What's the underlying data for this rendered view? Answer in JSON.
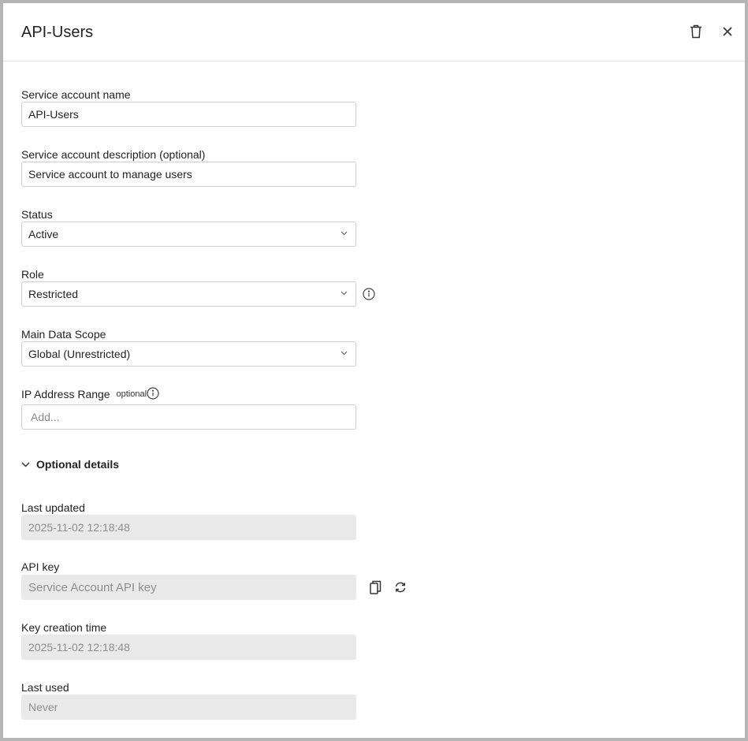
{
  "dialog": {
    "title": "API-Users",
    "delete_icon": "trash-icon",
    "close_icon": "close-icon"
  },
  "fields": {
    "name": {
      "label": "Service account name",
      "value": "API-Users"
    },
    "description": {
      "label": "Service account description (optional)",
      "value": "Service account to manage users"
    },
    "status": {
      "label": "Status",
      "value": "Active"
    },
    "role": {
      "label": "Role",
      "value": "Restricted"
    },
    "scope": {
      "label": "Main Data Scope",
      "value": "Global (Unrestricted)"
    },
    "ip_range": {
      "label": "IP Address Range",
      "tag": "optional",
      "placeholder": "Add..."
    }
  },
  "optional_details": {
    "label": "Optional details",
    "last_updated": {
      "label": "Last updated",
      "value": "2025-11-02 12:18:48"
    },
    "api_key": {
      "label": "API key",
      "placeholder": "Service Account API key",
      "copy_icon": "copy-icon",
      "refresh_icon": "refresh-icon"
    },
    "key_creation": {
      "label": "Key creation time",
      "value": "2025-11-02 12:18:48"
    },
    "last_used": {
      "label": "Last used",
      "value": "Never"
    }
  },
  "colors": {
    "border": "#cfcfcf",
    "disabled_bg": "#e9e9e9",
    "frame": "#b5b5b5",
    "text": "#222222"
  }
}
